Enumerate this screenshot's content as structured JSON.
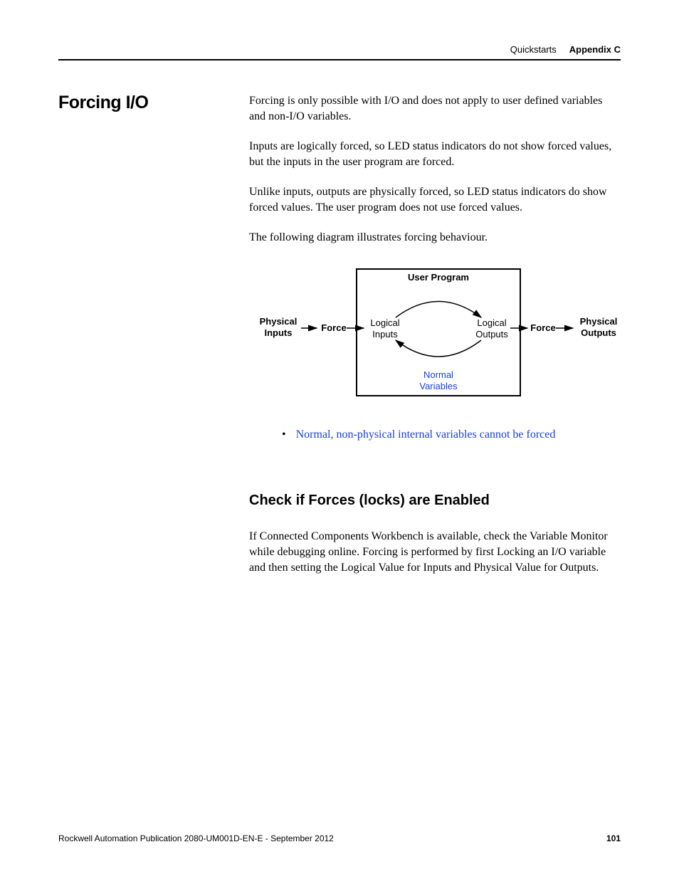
{
  "header": {
    "quickstarts": "Quickstarts",
    "appendix": "Appendix C"
  },
  "section": {
    "title": "Forcing I/O",
    "p1": "Forcing is only possible with I/O and does not apply to user defined variables and non-I/O variables.",
    "p2": "Inputs are logically forced, so LED status indicators do not show forced values, but the inputs in the user program are forced.",
    "p3": "Unlike inputs, outputs are physically forced, so LED status indicators do show forced values. The user program does not use forced values.",
    "p4": "The following diagram illustrates forcing behaviour.",
    "bullet": "Normal, non-physical internal variables cannot be forced",
    "subhead": "Check if Forces (locks) are Enabled",
    "p5": "If Connected Components Workbench is available, check the Variable Monitor while debugging online. Forcing is performed by first Locking an I/O variable and then setting the Logical Value for Inputs and Physical Value for Outputs."
  },
  "diagram": {
    "physical_inputs_l1": "Physical",
    "physical_inputs_l2": "Inputs",
    "force_left": "Force",
    "logical_inputs_l1": "Logical",
    "logical_inputs_l2": "Inputs",
    "user_program": "User Program",
    "logical_outputs_l1": "Logical",
    "logical_outputs_l2": "Outputs",
    "force_right": "Force",
    "physical_outputs_l1": "Physical",
    "physical_outputs_l2": "Outputs",
    "normal_l1": "Normal",
    "normal_l2": "Variables"
  },
  "footer": {
    "pub": "Rockwell Automation Publication 2080-UM001D-EN-E - September 2012",
    "page": "101"
  }
}
